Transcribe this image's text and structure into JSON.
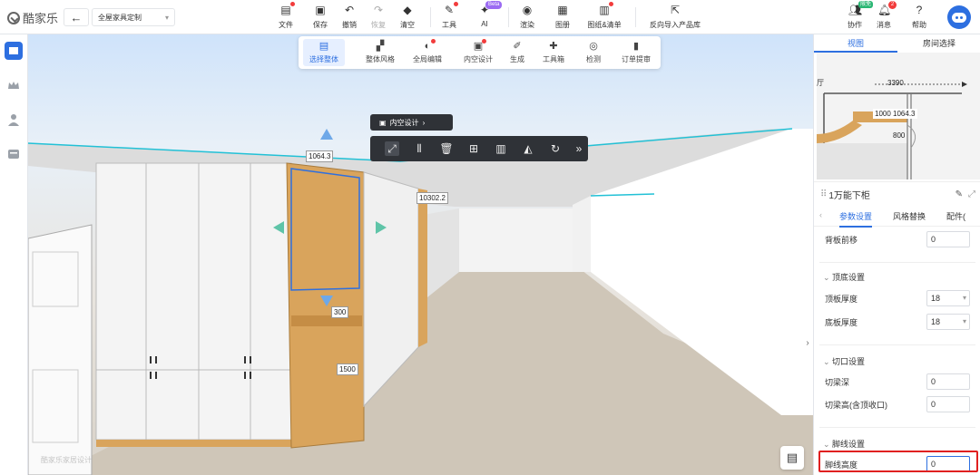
{
  "app": {
    "logo_text": "酷家乐",
    "project_name": "全屋家具定制"
  },
  "toolbar": [
    {
      "label": "文件",
      "icon": "file-icon",
      "dot": true
    },
    {
      "label": "保存",
      "icon": "save-icon",
      "dot": false
    },
    {
      "label": "撤销",
      "icon": "undo-icon",
      "dot": false
    },
    {
      "label": "恢复",
      "icon": "redo-icon",
      "dot": false,
      "disabled": true
    },
    {
      "label": "清空",
      "icon": "eraser-icon",
      "dot": false
    },
    {
      "label": "工具",
      "icon": "wrench-icon",
      "dot": true
    },
    {
      "label": "AI",
      "icon": "ai-icon",
      "dot": false
    },
    {
      "label": "渲染",
      "icon": "camera-icon",
      "dot": false
    },
    {
      "label": "图册",
      "icon": "album-icon",
      "dot": false
    },
    {
      "label": "图纸&清单",
      "icon": "drawing-icon",
      "dot": true
    },
    {
      "label": "反向导入产品库",
      "icon": "import-icon",
      "dot": false
    }
  ],
  "ai_badge": "Beta",
  "right_tools": {
    "collab": "协作",
    "collab_badge": "限免",
    "messages": "消息",
    "messages_count": "2",
    "help": "帮助"
  },
  "subtoolbar": [
    {
      "label": "选择整体",
      "active": true
    },
    {
      "label": "整体风格",
      "dot": false
    },
    {
      "label": "全局编辑",
      "dot": true
    },
    {
      "label": "内空设计",
      "dot": true
    },
    {
      "label": "生成",
      "dot": false
    },
    {
      "label": "工具箱",
      "dot": false
    },
    {
      "label": "检测",
      "dot": false
    },
    {
      "label": "订单提审",
      "dot": false
    }
  ],
  "context_button": {
    "label": "内空设计",
    "chevron": "›"
  },
  "dimensions": {
    "width_top": "1064.3",
    "depth": "10302.2",
    "gap": "300",
    "lower": "1500"
  },
  "watermark": "酷家乐家居设计",
  "panel": {
    "tabs": [
      "视图",
      "房间选择"
    ],
    "minimap": {
      "d1": "3390",
      "d2": "1000 1064.3",
      "d3": "800",
      "room_label": "厅"
    },
    "title": "1万能下柜",
    "prop_tabs": [
      "参数设置",
      "风格替换",
      "配件("
    ],
    "rows": {
      "back_offset": {
        "label": "背板前移",
        "value": "0"
      },
      "top_bottom_section": "顶底设置",
      "top_thickness": {
        "label": "顶板厚度",
        "value": "18"
      },
      "bottom_thickness": {
        "label": "底板厚度",
        "value": "18"
      },
      "cut_section": "切口设置",
      "cut_depth": {
        "label": "切梁深",
        "value": "0"
      },
      "cut_height": {
        "label": "切梁高(含顶收口)",
        "value": "0"
      },
      "skirt_section": "脚线设置",
      "skirt_height": {
        "label": "脚线高度",
        "value": "0"
      }
    }
  },
  "colors": {
    "accent": "#2d6fe0",
    "highlight": "#e02020",
    "wood": "#d9a45c"
  }
}
